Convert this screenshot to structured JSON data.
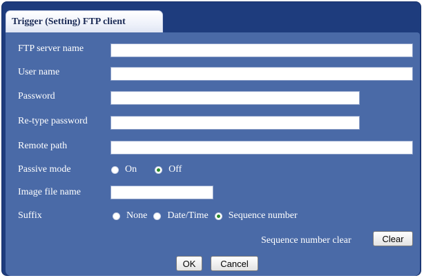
{
  "tab": {
    "title": "Trigger (Setting) FTP client"
  },
  "form": {
    "ftp_server_name": {
      "label": "FTP server name",
      "value": ""
    },
    "user_name": {
      "label": "User name",
      "value": ""
    },
    "password": {
      "label": "Password",
      "value": ""
    },
    "retype_password": {
      "label": "Re-type password",
      "value": ""
    },
    "remote_path": {
      "label": "Remote path",
      "value": ""
    },
    "passive_mode": {
      "label": "Passive mode",
      "options": [
        "On",
        "Off"
      ],
      "selected": "Off"
    },
    "image_file_name": {
      "label": "Image file name",
      "value": ""
    },
    "suffix": {
      "label": "Suffix",
      "options": [
        "None",
        "Date/Time",
        "Sequence number"
      ],
      "selected": "Sequence number"
    },
    "sequence_clear": {
      "label": "Sequence number clear",
      "button": "Clear"
    }
  },
  "buttons": {
    "ok": "OK",
    "cancel": "Cancel"
  },
  "colors": {
    "panel": "#1e3c7d",
    "content": "#4a6aa7",
    "radio_selected": "#2a8a2a"
  }
}
